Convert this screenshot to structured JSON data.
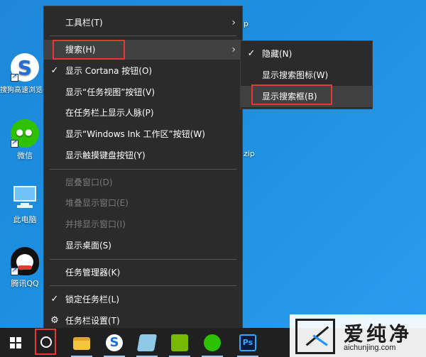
{
  "desktop": {
    "icons": [
      {
        "label": "搜狗高速浏览器"
      },
      {
        "label": "微信"
      },
      {
        "label": "此电脑"
      },
      {
        "label": "腾讯QQ"
      }
    ],
    "partial_labels": [
      "p",
      "zip"
    ]
  },
  "context_menu": {
    "items": [
      {
        "label": "工具栏(T)",
        "has_submenu": true,
        "checked": false,
        "disabled": false
      },
      {
        "label": "搜索(H)",
        "has_submenu": true,
        "checked": false,
        "disabled": false
      },
      {
        "label": "显示 Cortana 按钮(O)",
        "has_submenu": false,
        "checked": true,
        "disabled": false
      },
      {
        "label": "显示“任务视图”按钮(V)",
        "has_submenu": false,
        "checked": false,
        "disabled": false
      },
      {
        "label": "在任务栏上显示人脉(P)",
        "has_submenu": false,
        "checked": false,
        "disabled": false
      },
      {
        "label": "显示“Windows Ink 工作区”按钮(W)",
        "has_submenu": false,
        "checked": false,
        "disabled": false
      },
      {
        "label": "显示触摸键盘按钮(Y)",
        "has_submenu": false,
        "checked": false,
        "disabled": false
      },
      {
        "label": "层叠窗口(D)",
        "has_submenu": false,
        "checked": false,
        "disabled": true
      },
      {
        "label": "堆叠显示窗口(E)",
        "has_submenu": false,
        "checked": false,
        "disabled": true
      },
      {
        "label": "并排显示窗口(I)",
        "has_submenu": false,
        "checked": false,
        "disabled": true
      },
      {
        "label": "显示桌面(S)",
        "has_submenu": false,
        "checked": false,
        "disabled": false
      },
      {
        "label": "任务管理器(K)",
        "has_submenu": false,
        "checked": false,
        "disabled": false
      },
      {
        "label": "锁定任务栏(L)",
        "has_submenu": false,
        "checked": true,
        "disabled": false
      },
      {
        "label": "任务栏设置(T)",
        "has_submenu": false,
        "checked": false,
        "disabled": false,
        "icon": "gear-icon"
      }
    ],
    "check_glyph": "✓",
    "arrow_glyph": "›"
  },
  "search_submenu": {
    "items": [
      {
        "label": "隐藏(N)",
        "checked": true
      },
      {
        "label": "显示搜索图标(W)",
        "checked": false
      },
      {
        "label": "显示搜索框(B)",
        "checked": false
      }
    ]
  },
  "taskbar": {
    "apps": [
      "start-button",
      "cortana-button",
      "file-explorer",
      "sogou-browser",
      "notepad-app",
      "nvidia-app",
      "wechat-app",
      "photoshop-app"
    ],
    "ps_label": "Ps"
  },
  "watermark": {
    "title": "爱纯净",
    "url": "aichunjing.com"
  },
  "colors": {
    "menu_bg": "#2b2b2b",
    "highlight_box": "#e53935",
    "desktop_bg": "#1f87d8"
  }
}
